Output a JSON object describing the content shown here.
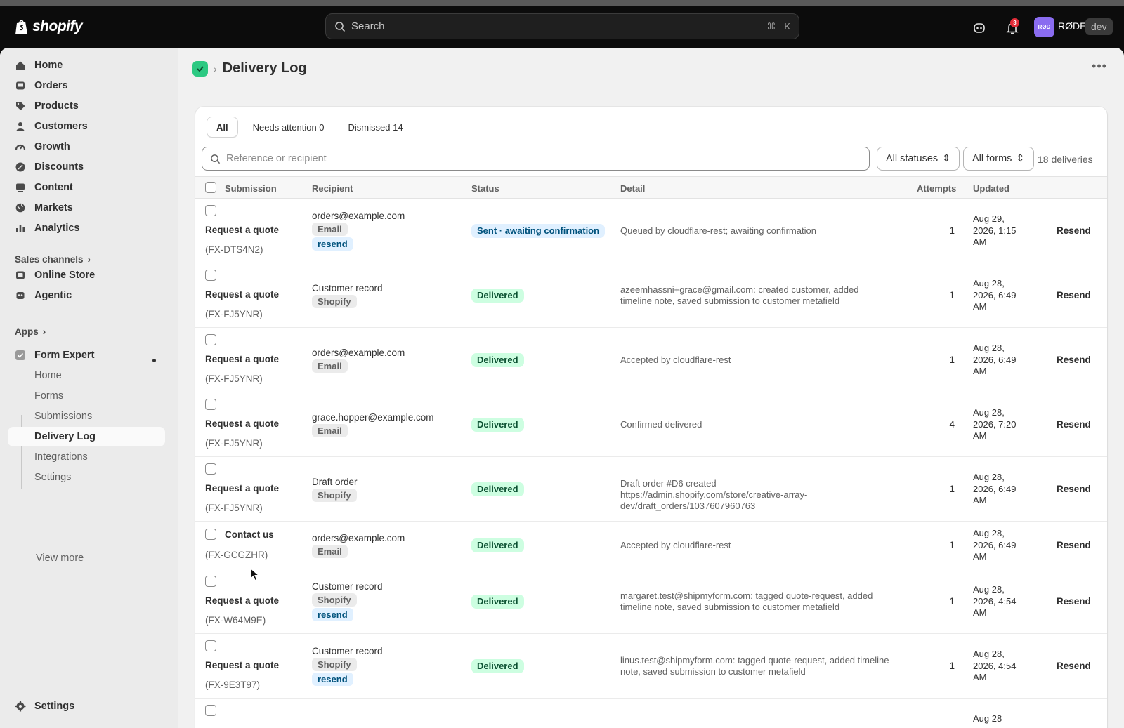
{
  "topbar": {
    "logo_text": "shopify",
    "search_placeholder": "Search",
    "shortcut_cmd": "⌘",
    "shortcut_key": "K",
    "notification_count": "3",
    "avatar_initials": "RØD",
    "store_name": "RØDE",
    "env_badge": "dev"
  },
  "sidebar": {
    "main": [
      {
        "label": "Home",
        "icon": "home-icon"
      },
      {
        "label": "Orders",
        "icon": "inbox-icon"
      },
      {
        "label": "Products",
        "icon": "tag-icon"
      },
      {
        "label": "Customers",
        "icon": "person-icon"
      },
      {
        "label": "Growth",
        "icon": "gauge-icon"
      },
      {
        "label": "Discounts",
        "icon": "discount-icon"
      },
      {
        "label": "Content",
        "icon": "content-icon"
      },
      {
        "label": "Markets",
        "icon": "globe-icon"
      },
      {
        "label": "Analytics",
        "icon": "bar-chart-icon"
      }
    ],
    "sales_channels_label": "Sales channels",
    "channels": [
      {
        "label": "Online Store",
        "icon": "store-icon"
      },
      {
        "label": "Agentic",
        "icon": "robot-icon"
      }
    ],
    "apps_label": "Apps",
    "app": {
      "label": "Form Expert",
      "subitems": [
        "Home",
        "Forms",
        "Submissions",
        "Delivery Log",
        "Integrations",
        "Settings"
      ],
      "active": "Delivery Log",
      "view_more": "View more"
    },
    "settings_label": "Settings"
  },
  "page": {
    "title": "Delivery Log",
    "more_label": "•••"
  },
  "tabs": [
    {
      "label": "All"
    },
    {
      "label": "Needs attention 0"
    },
    {
      "label": "Dismissed 14"
    }
  ],
  "filters": {
    "search_placeholder": "Reference or recipient",
    "status_select": "All statuses",
    "form_select": "All forms",
    "count": "18 deliveries"
  },
  "table": {
    "columns": [
      "Submission",
      "Recipient",
      "Status",
      "Detail",
      "Attempts",
      "Updated"
    ],
    "rows": [
      {
        "submission": "Request a quote",
        "ref": "(FX-DTS4N2)",
        "recipient": "orders@example.com",
        "tags": [
          "Email",
          "resend"
        ],
        "status": "Sent · awaiting confirmation",
        "status_kind": "sent",
        "detail": "Queued by cloudflare-rest; awaiting confirmation",
        "attempts": "1",
        "updated": "Aug 29, 2026, 1:15 AM",
        "action": "Resend"
      },
      {
        "submission": "Request a quote",
        "ref": "(FX-FJ5YNR)",
        "recipient": "Customer record",
        "tags": [
          "Shopify"
        ],
        "status": "Delivered",
        "status_kind": "ok",
        "detail": "azeemhassni+grace@gmail.com: created customer, added timeline note, saved submission to customer metafield",
        "attempts": "1",
        "updated": "Aug 28, 2026, 6:49 AM",
        "action": "Resend"
      },
      {
        "submission": "Request a quote",
        "ref": "(FX-FJ5YNR)",
        "recipient": "orders@example.com",
        "tags": [
          "Email"
        ],
        "status": "Delivered",
        "status_kind": "ok",
        "detail": "Accepted by cloudflare-rest",
        "attempts": "1",
        "updated": "Aug 28, 2026, 6:49 AM",
        "action": "Resend"
      },
      {
        "submission": "Request a quote",
        "ref": "(FX-FJ5YNR)",
        "recipient": "grace.hopper@example.com",
        "tags": [
          "Email"
        ],
        "status": "Delivered",
        "status_kind": "ok",
        "detail": "Confirmed delivered",
        "attempts": "4",
        "updated": "Aug 28, 2026, 7:20 AM",
        "action": "Resend"
      },
      {
        "submission": "Request a quote",
        "ref": "(FX-FJ5YNR)",
        "recipient": "Draft order",
        "tags": [
          "Shopify"
        ],
        "status": "Delivered",
        "status_kind": "ok",
        "detail": "Draft order #D6 created — https://admin.shopify.com/store/creative-array-dev/draft_orders/1037607960763",
        "attempts": "1",
        "updated": "Aug 28, 2026, 6:49 AM",
        "action": "Resend"
      },
      {
        "submission": "Contact us",
        "ref": "(FX-GCGZHR)",
        "recipient": "orders@example.com",
        "tags": [
          "Email"
        ],
        "status": "Delivered",
        "status_kind": "ok",
        "detail": "Accepted by cloudflare-rest",
        "attempts": "1",
        "updated": "Aug 28, 2026, 6:49 AM",
        "action": "Resend"
      },
      {
        "submission": "Request a quote",
        "ref": "(FX-W64M9E)",
        "recipient": "Customer record",
        "tags": [
          "Shopify",
          "resend"
        ],
        "status": "Delivered",
        "status_kind": "ok",
        "detail": "margaret.test@shipmyform.com: tagged quote-request, added timeline note, saved submission to customer metafield",
        "attempts": "1",
        "updated": "Aug 28, 2026, 4:54 AM",
        "action": "Resend"
      },
      {
        "submission": "Request a quote",
        "ref": "(FX-9E3T97)",
        "recipient": "Customer record",
        "tags": [
          "Shopify",
          "resend"
        ],
        "status": "Delivered",
        "status_kind": "ok",
        "detail": "linus.test@shipmyform.com: tagged quote-request, added timeline note, saved submission to customer metafield",
        "attempts": "1",
        "updated": "Aug 28, 2026, 4:54 AM",
        "action": "Resend"
      }
    ],
    "partial_row_updated": "Aug 28"
  }
}
